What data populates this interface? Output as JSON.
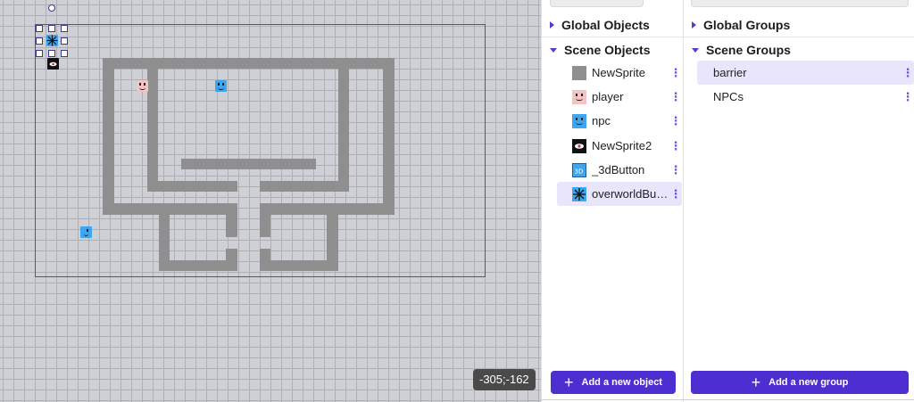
{
  "canvas": {
    "coords_readout": "-305;-162"
  },
  "objects_panel": {
    "global_title": "Global Objects",
    "scene_title": "Scene Objects",
    "items": [
      {
        "label": "NewSprite",
        "icon": "gray-square-icon"
      },
      {
        "label": "player",
        "icon": "pink-face-icon"
      },
      {
        "label": "npc",
        "icon": "blue-face-icon"
      },
      {
        "label": "NewSprite2",
        "icon": "dark-eye-icon"
      },
      {
        "label": "_3dButton",
        "icon": "3d-button-icon"
      },
      {
        "label": "overworldBut…",
        "icon": "star-burst-icon",
        "selected": true
      }
    ],
    "add_label": "Add a new object"
  },
  "groups_panel": {
    "global_title": "Global Groups",
    "scene_title": "Scene Groups",
    "items": [
      {
        "label": "barrier",
        "selected": true
      },
      {
        "label": "NPCs"
      }
    ],
    "add_label": "Add a new group"
  },
  "colors": {
    "accent": "#4d2ed0",
    "selected_row": "#e9e6fb",
    "wall": "#8f8f8f"
  }
}
